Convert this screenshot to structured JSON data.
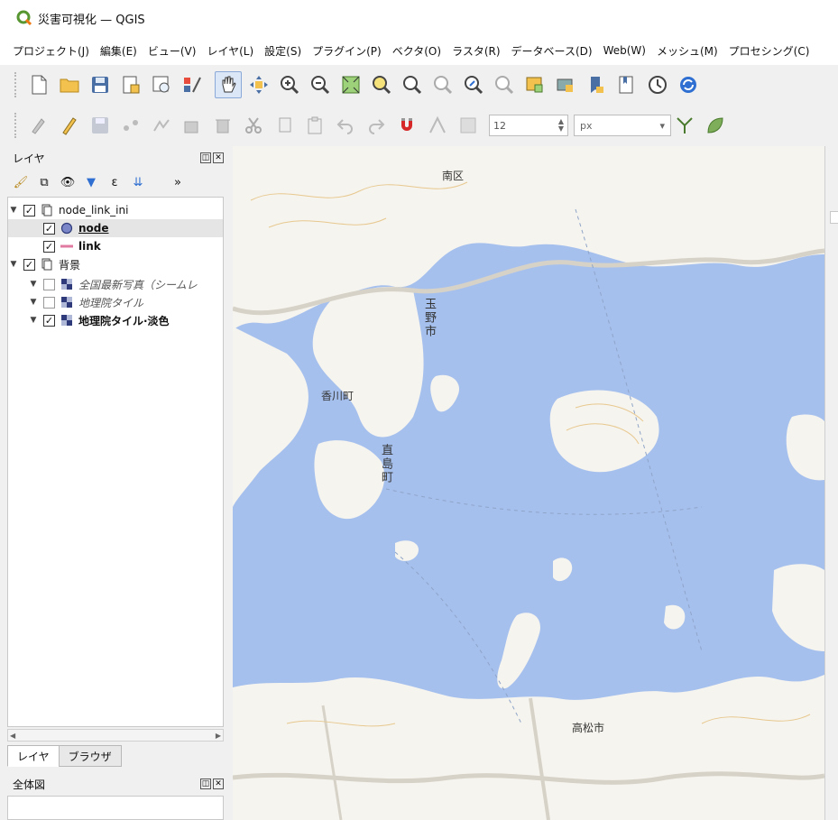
{
  "window": {
    "title": "災害可視化 — QGIS"
  },
  "menubar": {
    "items": [
      "プロジェクト(J)",
      "編集(E)",
      "ビュー(V)",
      "レイヤ(L)",
      "設定(S)",
      "プラグイン(P)",
      "ベクタ(O)",
      "ラスタ(R)",
      "データベース(D)",
      "Web(W)",
      "メッシュ(M)",
      "プロセシング(C)"
    ]
  },
  "attribute_toolbar": {
    "symbol_size_value": "12",
    "symbol_size_unit": "px"
  },
  "layers_panel": {
    "title": "レイヤ",
    "tree": [
      {
        "label": "node_link_ini",
        "checked": true,
        "type": "group"
      },
      {
        "label": "node",
        "checked": true,
        "type": "point-layer",
        "selected": true
      },
      {
        "label": "link",
        "checked": true,
        "type": "line-layer"
      },
      {
        "label": "背景",
        "checked": true,
        "type": "group"
      },
      {
        "label": "全国最新写真（シームレ",
        "checked": false,
        "type": "raster"
      },
      {
        "label": "地理院タイル",
        "checked": false,
        "type": "raster"
      },
      {
        "label": "地理院タイル·淡色",
        "checked": true,
        "type": "raster"
      }
    ]
  },
  "bottom_tabs": {
    "tabs": [
      "レイヤ",
      "ブラウザ"
    ],
    "active": "レイヤ"
  },
  "overview_panel": {
    "title": "全体図"
  },
  "map_labels": {
    "minami_ku": "南区",
    "tamano": "玉野市",
    "kagawa_cho": "香川町",
    "naoshima_cho": "直島町",
    "takamatsu": "高松市"
  },
  "colors": {
    "sea": "#a6c0ee",
    "land": "#f6f4ee",
    "road": "#d6d2c8",
    "contour": "#e7c88f"
  }
}
